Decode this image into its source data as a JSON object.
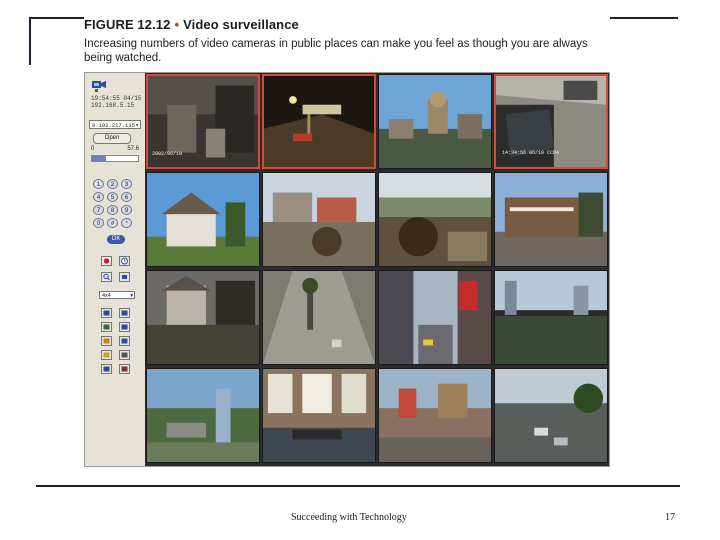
{
  "figure": {
    "number": "FIGURE 12.12",
    "bullet": "•",
    "title": "Video surveillance",
    "caption": "Increasing numbers of video cameras in public places can make you feel as though you are always being watched."
  },
  "panel": {
    "info_line1": "19:54:55 04/15",
    "info_line2": "192.168.5.15",
    "ip_value": "0.192.217.135",
    "open_label": "Open",
    "range_low": "0",
    "range_high": "57.6",
    "progress": 0.3,
    "keypad": [
      "1",
      "2",
      "3",
      "4",
      "5",
      "6",
      "7",
      "8",
      "9",
      "0",
      "#",
      "*"
    ],
    "ok_label": "OK",
    "camera_select": "4x4"
  },
  "cameras": [
    {
      "name": "camera-1",
      "osd": "2002/06/10"
    },
    {
      "name": "camera-2",
      "osd": ""
    },
    {
      "name": "camera-3",
      "osd": ""
    },
    {
      "name": "camera-4",
      "osd": "14:34:56 06/10 CCD4"
    },
    {
      "name": "camera-5",
      "osd": ""
    },
    {
      "name": "camera-6",
      "osd": ""
    },
    {
      "name": "camera-7",
      "osd": ""
    },
    {
      "name": "camera-8",
      "osd": ""
    },
    {
      "name": "camera-9",
      "osd": ""
    },
    {
      "name": "camera-10",
      "osd": ""
    },
    {
      "name": "camera-11",
      "osd": ""
    },
    {
      "name": "camera-12",
      "osd": ""
    },
    {
      "name": "camera-13",
      "osd": ""
    },
    {
      "name": "camera-14",
      "osd": ""
    },
    {
      "name": "camera-15",
      "osd": ""
    },
    {
      "name": "camera-16",
      "osd": ""
    }
  ],
  "footer": {
    "text": "Succeeding with Technology",
    "page": "17"
  },
  "colors": {
    "selected_border": "#d44a3a",
    "panel_bg": "#e7e2d6",
    "rule": "#1a1f3c"
  }
}
